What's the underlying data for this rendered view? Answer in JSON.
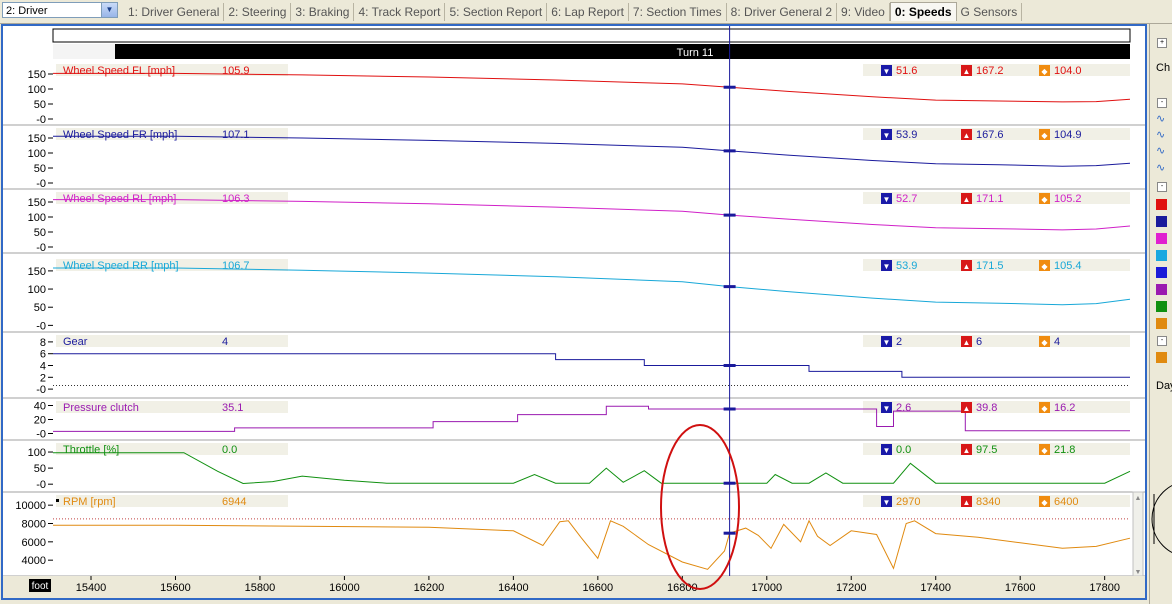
{
  "toolbar": {
    "driver_select": "2: Driver"
  },
  "tabs": [
    {
      "label": "1: Driver General",
      "active": false
    },
    {
      "label": "2: Steering",
      "active": false
    },
    {
      "label": "3: Braking",
      "active": false
    },
    {
      "label": "4: Track Report",
      "active": false
    },
    {
      "label": "5: Section Report",
      "active": false
    },
    {
      "label": "6: Lap Report",
      "active": false
    },
    {
      "label": "7: Section Times",
      "active": false
    },
    {
      "label": "8: Driver General 2",
      "active": false
    },
    {
      "label": "9: Video",
      "active": false
    },
    {
      "label": "0: Speeds",
      "active": true
    },
    {
      "label": "G Sensors",
      "active": false
    }
  ],
  "section_label": "Turn 11",
  "x_axis": {
    "unit_label": "foot",
    "ticks": [
      15400,
      15600,
      15800,
      16000,
      16200,
      16400,
      16600,
      16800,
      17000,
      17200,
      17400,
      17600,
      17800
    ],
    "range": [
      15310,
      17860
    ]
  },
  "cursor_x": 16912,
  "channels": [
    {
      "key": "fl",
      "name": "Wheel Speed FL [mph]",
      "value": "105.9",
      "min": "51.6",
      "max": "167.2",
      "avg": "104.0",
      "color": "#e01010",
      "yticks": [
        "150",
        "100",
        "50",
        "-0"
      ],
      "yrange": [
        -10,
        180
      ],
      "points": [
        [
          15310,
          152
        ],
        [
          15600,
          152
        ],
        [
          15900,
          147
        ],
        [
          16200,
          140
        ],
        [
          16500,
          130
        ],
        [
          16800,
          117
        ],
        [
          16912,
          105.9
        ],
        [
          17050,
          92
        ],
        [
          17250,
          74
        ],
        [
          17400,
          63
        ],
        [
          17550,
          60
        ],
        [
          17700,
          57
        ],
        [
          17780,
          58
        ],
        [
          17860,
          66
        ]
      ]
    },
    {
      "key": "fr",
      "name": "Wheel Speed FR [mph]",
      "value": "107.1",
      "min": "53.9",
      "max": "167.6",
      "avg": "104.9",
      "color": "#1a1a9c",
      "yticks": [
        "150",
        "100",
        "50",
        "-0"
      ],
      "yrange": [
        -10,
        180
      ],
      "points": [
        [
          15310,
          156
        ],
        [
          15600,
          156
        ],
        [
          15900,
          150
        ],
        [
          16200,
          142
        ],
        [
          16500,
          132
        ],
        [
          16800,
          119
        ],
        [
          16912,
          107.1
        ],
        [
          17050,
          93
        ],
        [
          17250,
          75
        ],
        [
          17400,
          64
        ],
        [
          17550,
          61
        ],
        [
          17700,
          56
        ],
        [
          17780,
          58
        ],
        [
          17860,
          66
        ]
      ]
    },
    {
      "key": "rl",
      "name": "Wheel Speed RL [mph]",
      "value": "106.3",
      "min": "52.7",
      "max": "171.1",
      "avg": "105.2",
      "color": "#d020c8",
      "yticks": [
        "150",
        "100",
        "50",
        "-0"
      ],
      "yrange": [
        -10,
        180
      ],
      "points": [
        [
          15310,
          158
        ],
        [
          15600,
          158
        ],
        [
          15900,
          152
        ],
        [
          16200,
          144
        ],
        [
          16500,
          133
        ],
        [
          16800,
          119
        ],
        [
          16912,
          106.3
        ],
        [
          17050,
          93
        ],
        [
          17250,
          75
        ],
        [
          17400,
          64
        ],
        [
          17550,
          61
        ],
        [
          17700,
          57
        ],
        [
          17780,
          60
        ],
        [
          17860,
          70
        ]
      ]
    },
    {
      "key": "rr",
      "name": "Wheel Speed RR [mph]",
      "value": "106.7",
      "min": "53.9",
      "max": "171.5",
      "avg": "105.4",
      "color": "#18a8d8",
      "yticks": [
        "150",
        "100",
        "50",
        "-0"
      ],
      "yrange": [
        -10,
        180
      ],
      "points": [
        [
          15310,
          158
        ],
        [
          15600,
          158
        ],
        [
          15900,
          152
        ],
        [
          16200,
          144
        ],
        [
          16500,
          134
        ],
        [
          16800,
          120
        ],
        [
          16912,
          106.7
        ],
        [
          17050,
          93
        ],
        [
          17250,
          75
        ],
        [
          17400,
          64
        ],
        [
          17550,
          61
        ],
        [
          17700,
          57
        ],
        [
          17780,
          60
        ],
        [
          17860,
          72
        ]
      ]
    },
    {
      "key": "gear",
      "name": "Gear",
      "value": "4",
      "min": "2",
      "max": "6",
      "avg": "4",
      "color": "#1a1a9c",
      "yticks": [
        "8",
        "6",
        "4",
        "2",
        "-0"
      ],
      "yrange": [
        -1,
        9
      ],
      "step": true,
      "points": [
        [
          15310,
          6
        ],
        [
          16500,
          6
        ],
        [
          16500,
          5
        ],
        [
          16710,
          5
        ],
        [
          16710,
          4
        ],
        [
          17100,
          4
        ],
        [
          17100,
          3
        ],
        [
          17320,
          3
        ],
        [
          17320,
          2
        ],
        [
          17860,
          2
        ]
      ]
    },
    {
      "key": "clutch",
      "name": "Pressure clutch",
      "value": "35.1",
      "min": "2.6",
      "max": "39.8",
      "avg": "16.2",
      "color": "#9a1ab0",
      "yticks": [
        "40",
        "20",
        "-0"
      ],
      "yrange": [
        -5,
        45
      ],
      "step": true,
      "points": [
        [
          15310,
          3
        ],
        [
          15740,
          3
        ],
        [
          15740,
          8
        ],
        [
          16210,
          8
        ],
        [
          16210,
          17
        ],
        [
          16410,
          17
        ],
        [
          16410,
          27
        ],
        [
          16620,
          27
        ],
        [
          16620,
          39
        ],
        [
          16720,
          39
        ],
        [
          16720,
          35
        ],
        [
          17260,
          35
        ],
        [
          17260,
          10
        ],
        [
          17300,
          10
        ],
        [
          17300,
          32
        ],
        [
          17470,
          32
        ],
        [
          17470,
          4
        ],
        [
          17860,
          4
        ]
      ]
    },
    {
      "key": "throttle",
      "name": "Throttle [%]",
      "value": "0.0",
      "min": "0.0",
      "max": "97.5",
      "avg": "21.8",
      "color": "#109010",
      "yticks": [
        "100",
        "50",
        "-0"
      ],
      "yrange": [
        -15,
        125
      ],
      "points": [
        [
          15310,
          98
        ],
        [
          15620,
          98
        ],
        [
          15700,
          40
        ],
        [
          15760,
          2
        ],
        [
          15830,
          8
        ],
        [
          15900,
          25
        ],
        [
          16000,
          12
        ],
        [
          16100,
          3
        ],
        [
          16400,
          3
        ],
        [
          16450,
          30
        ],
        [
          16500,
          3
        ],
        [
          16580,
          3
        ],
        [
          16620,
          50
        ],
        [
          16660,
          6
        ],
        [
          16710,
          42
        ],
        [
          16750,
          3
        ],
        [
          16900,
          3
        ],
        [
          17000,
          3
        ],
        [
          17020,
          30
        ],
        [
          17060,
          3
        ],
        [
          17100,
          3
        ],
        [
          17140,
          35
        ],
        [
          17180,
          3
        ],
        [
          17300,
          3
        ],
        [
          17340,
          65
        ],
        [
          17400,
          3
        ],
        [
          17800,
          3
        ],
        [
          17860,
          40
        ]
      ]
    },
    {
      "key": "rpm",
      "name": "RPM [rpm]",
      "value": "6944",
      "min": "2970",
      "max": "8340",
      "avg": "6400",
      "color": "#e08a10",
      "yticks": [
        "10000",
        "8000",
        "6000",
        "4000"
      ],
      "yrange": [
        2600,
        11000
      ],
      "points": [
        [
          15310,
          7800
        ],
        [
          15600,
          7800
        ],
        [
          15900,
          7700
        ],
        [
          16200,
          7600
        ],
        [
          16400,
          7200
        ],
        [
          16470,
          5600
        ],
        [
          16510,
          8200
        ],
        [
          16530,
          8300
        ],
        [
          16560,
          6500
        ],
        [
          16600,
          4200
        ],
        [
          16630,
          8300
        ],
        [
          16660,
          7700
        ],
        [
          16720,
          5700
        ],
        [
          16800,
          3800
        ],
        [
          16860,
          3000
        ],
        [
          16900,
          5000
        ],
        [
          16912,
          6944
        ],
        [
          16950,
          7500
        ],
        [
          16980,
          6700
        ],
        [
          17010,
          5300
        ],
        [
          17040,
          7900
        ],
        [
          17080,
          6000
        ],
        [
          17100,
          8300
        ],
        [
          17120,
          6600
        ],
        [
          17150,
          5600
        ],
        [
          17200,
          7200
        ],
        [
          17260,
          6800
        ],
        [
          17300,
          3100
        ],
        [
          17330,
          8000
        ],
        [
          17350,
          8300
        ],
        [
          17400,
          6900
        ],
        [
          17500,
          6500
        ],
        [
          17600,
          5900
        ],
        [
          17700,
          5300
        ],
        [
          17780,
          5500
        ],
        [
          17860,
          6400
        ]
      ]
    }
  ]
}
